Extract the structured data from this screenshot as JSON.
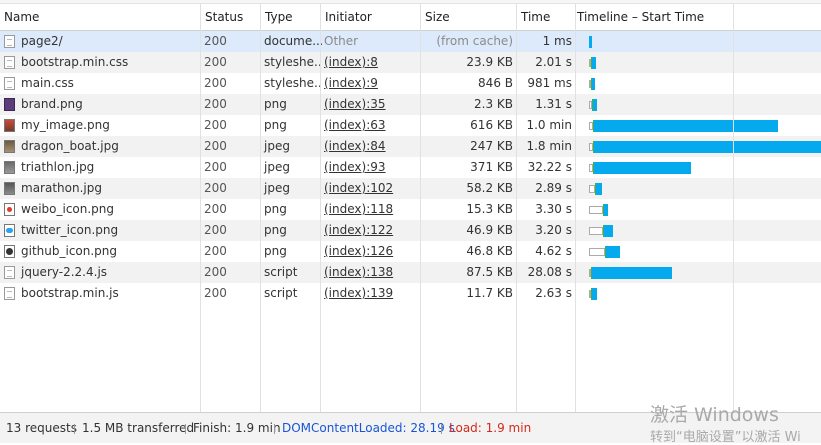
{
  "columns": {
    "name": "Name",
    "status": "Status",
    "type": "Type",
    "initiator": "Initiator",
    "size": "Size",
    "time": "Time",
    "timeline": "Timeline – Start Time"
  },
  "rows": [
    {
      "name": "page2/",
      "icon": "doc",
      "status": "200",
      "type": "docume...",
      "initiator": "Other",
      "initiator_link": false,
      "size": "(from cache)",
      "time": "1 ms",
      "bar": {
        "wait": 0,
        "green": 0,
        "blue": 3
      }
    },
    {
      "name": "bootstrap.min.css",
      "icon": "css",
      "status": "200",
      "type": "styleshe...",
      "initiator": "(index):8",
      "initiator_link": true,
      "size": "23.9 KB",
      "time": "2.01 s",
      "bar": {
        "wait": 2,
        "green": 1,
        "blue": 4
      }
    },
    {
      "name": "main.css",
      "icon": "css",
      "status": "200",
      "type": "styleshe...",
      "initiator": "(index):9",
      "initiator_link": true,
      "size": "846 B",
      "time": "981 ms",
      "bar": {
        "wait": 2,
        "green": 1,
        "blue": 3
      }
    },
    {
      "name": "brand.png",
      "icon": "brand",
      "status": "200",
      "type": "png",
      "initiator": "(index):35",
      "initiator_link": true,
      "size": "2.3 KB",
      "time": "1.31 s",
      "bar": {
        "wait": 3,
        "green": 1,
        "blue": 4
      }
    },
    {
      "name": "my_image.png",
      "icon": "my",
      "status": "200",
      "type": "png",
      "initiator": "(index):63",
      "initiator_link": true,
      "size": "616 KB",
      "time": "1.0 min",
      "bar": {
        "wait": 4,
        "green": 1,
        "blue": 184
      }
    },
    {
      "name": "dragon_boat.jpg",
      "icon": "dragon",
      "status": "200",
      "type": "jpeg",
      "initiator": "(index):84",
      "initiator_link": true,
      "size": "247 KB",
      "time": "1.8 min",
      "bar": {
        "wait": 4,
        "green": 1,
        "blue": 228
      }
    },
    {
      "name": "triathlon.jpg",
      "icon": "tri",
      "status": "200",
      "type": "jpeg",
      "initiator": "(index):93",
      "initiator_link": true,
      "size": "371 KB",
      "time": "32.22 s",
      "bar": {
        "wait": 4,
        "green": 1,
        "blue": 97
      }
    },
    {
      "name": "marathon.jpg",
      "icon": "mara",
      "status": "200",
      "type": "jpeg",
      "initiator": "(index):102",
      "initiator_link": true,
      "size": "58.2 KB",
      "time": "2.89 s",
      "bar": {
        "wait": 6,
        "green": 1,
        "blue": 6
      }
    },
    {
      "name": "weibo_icon.png",
      "icon": "weibo",
      "status": "200",
      "type": "png",
      "initiator": "(index):118",
      "initiator_link": true,
      "size": "15.3 KB",
      "time": "3.30 s",
      "bar": {
        "wait": 14,
        "green": 1,
        "blue": 4
      }
    },
    {
      "name": "twitter_icon.png",
      "icon": "twitter",
      "status": "200",
      "type": "png",
      "initiator": "(index):122",
      "initiator_link": true,
      "size": "46.9 KB",
      "time": "3.20 s",
      "bar": {
        "wait": 14,
        "green": 1,
        "blue": 9
      }
    },
    {
      "name": "github_icon.png",
      "icon": "github",
      "status": "200",
      "type": "png",
      "initiator": "(index):126",
      "initiator_link": true,
      "size": "46.8 KB",
      "time": "4.62 s",
      "bar": {
        "wait": 16,
        "green": 1,
        "blue": 14
      }
    },
    {
      "name": "jquery-2.2.4.js",
      "icon": "js",
      "status": "200",
      "type": "script",
      "initiator": "(index):138",
      "initiator_link": true,
      "size": "87.5 KB",
      "time": "28.08 s",
      "bar": {
        "wait": 2,
        "green": 1,
        "blue": 80
      }
    },
    {
      "name": "bootstrap.min.js",
      "icon": "js",
      "status": "200",
      "type": "script",
      "initiator": "(index):139",
      "initiator_link": true,
      "size": "11.7 KB",
      "time": "2.63 s",
      "bar": {
        "wait": 2,
        "green": 1,
        "blue": 5
      }
    }
  ],
  "footer": {
    "requests": "13 requests",
    "transferred": "1.5 MB transferred",
    "finish": "Finish: 1.9 min",
    "dom": "DOMContentLoaded: 28.19 s",
    "load": "Load: 1.9 min"
  },
  "watermark": {
    "line1": "激活 Windows",
    "line2": "转到“电脑设置”以激活 Wi"
  },
  "colors": {
    "selected_row": "#dceafb",
    "bar_blue": "#05a9ee",
    "bar_green": "#3cb34a",
    "dom_text": "#1a55d6",
    "load_text": "#d42a1a"
  }
}
